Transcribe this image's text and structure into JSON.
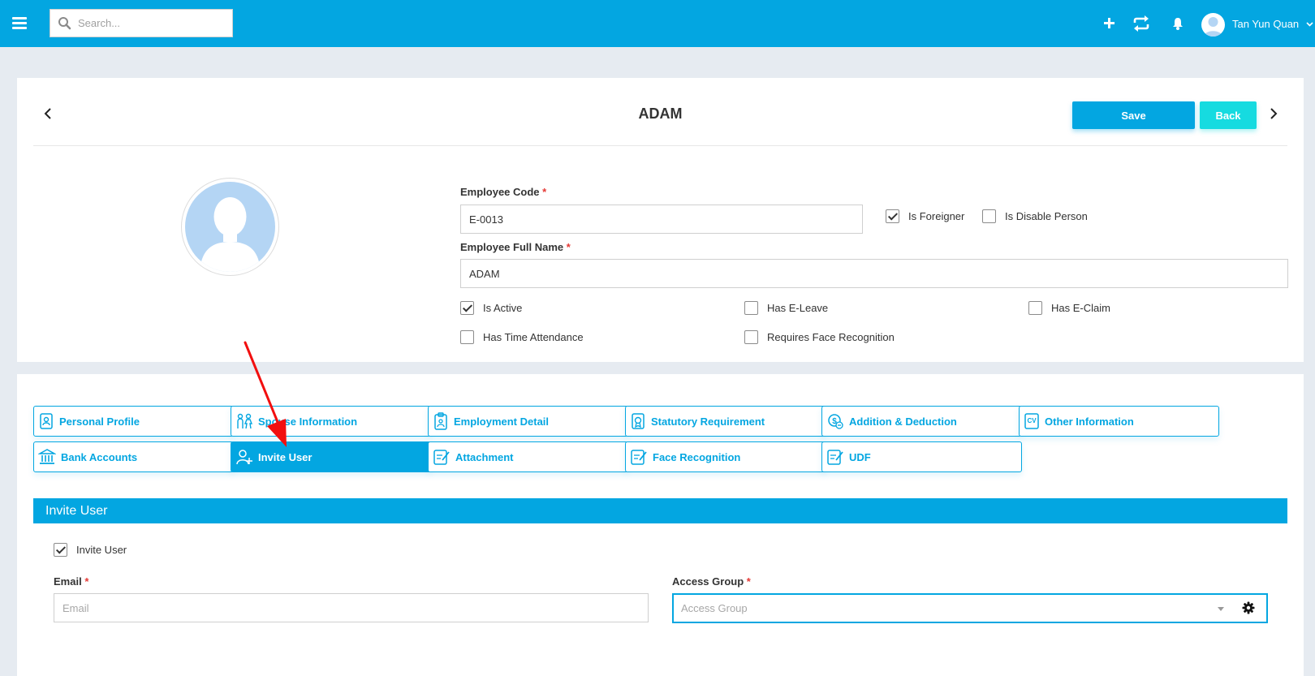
{
  "topbar": {
    "search_placeholder": "Search...",
    "user_name": "Tan Yun Quan",
    "icons": [
      "menu-icon",
      "search-icon",
      "plus-icon",
      "sync-icon",
      "bell-icon",
      "avatar",
      "chevron-down-icon"
    ]
  },
  "header": {
    "title": "ADAM",
    "save_label": "Save",
    "back_label": "Back"
  },
  "employee": {
    "code_label": "Employee Code",
    "code_value": "E-0013",
    "name_label": "Employee Full Name",
    "name_value": "ADAM",
    "required_mark": "*"
  },
  "flags": {
    "is_foreigner": {
      "label": "Is Foreigner",
      "checked": true
    },
    "is_disable_person": {
      "label": "Is Disable Person",
      "checked": false
    },
    "is_active": {
      "label": "Is Active",
      "checked": true
    },
    "has_eleave": {
      "label": "Has E-Leave",
      "checked": false
    },
    "has_eclaim": {
      "label": "Has E-Claim",
      "checked": false
    },
    "has_time_attendance": {
      "label": "Has Time Attendance",
      "checked": false
    },
    "requires_face_recognition": {
      "label": "Requires Face Recognition",
      "checked": false
    }
  },
  "tabs": [
    {
      "label": "Personal Profile",
      "icon": "profile-icon",
      "active": false
    },
    {
      "label": "Spouse Information",
      "icon": "couple-icon",
      "active": false
    },
    {
      "label": "Employment Detail",
      "icon": "clipboard-icon",
      "active": false
    },
    {
      "label": "Statutory Requirement",
      "icon": "certificate-icon",
      "active": false
    },
    {
      "label": "Addition & Deduction",
      "icon": "coin-icon",
      "active": false
    },
    {
      "label": "Other Information",
      "icon": "cv-icon",
      "active": false
    },
    {
      "label": "Bank Accounts",
      "icon": "bank-icon",
      "active": false
    },
    {
      "label": "Invite User",
      "icon": "add-user-icon",
      "active": true
    },
    {
      "label": "Attachment",
      "icon": "edit-doc-icon",
      "active": false
    },
    {
      "label": "Face Recognition",
      "icon": "edit-doc-icon",
      "active": false
    },
    {
      "label": "UDF",
      "icon": "edit-doc-icon",
      "active": false
    }
  ],
  "invite_section": {
    "title": "Invite User",
    "invite_checkbox": {
      "label": "Invite User",
      "checked": true
    },
    "email_label": "Email",
    "email_placeholder": "Email",
    "email_value": "",
    "access_group_label": "Access Group",
    "access_group_placeholder": "Access Group"
  },
  "colors": {
    "primary": "#03a6e1",
    "accent": "#16dbe0",
    "required": "#e53935",
    "annotation_arrow": "#f20f0f"
  }
}
